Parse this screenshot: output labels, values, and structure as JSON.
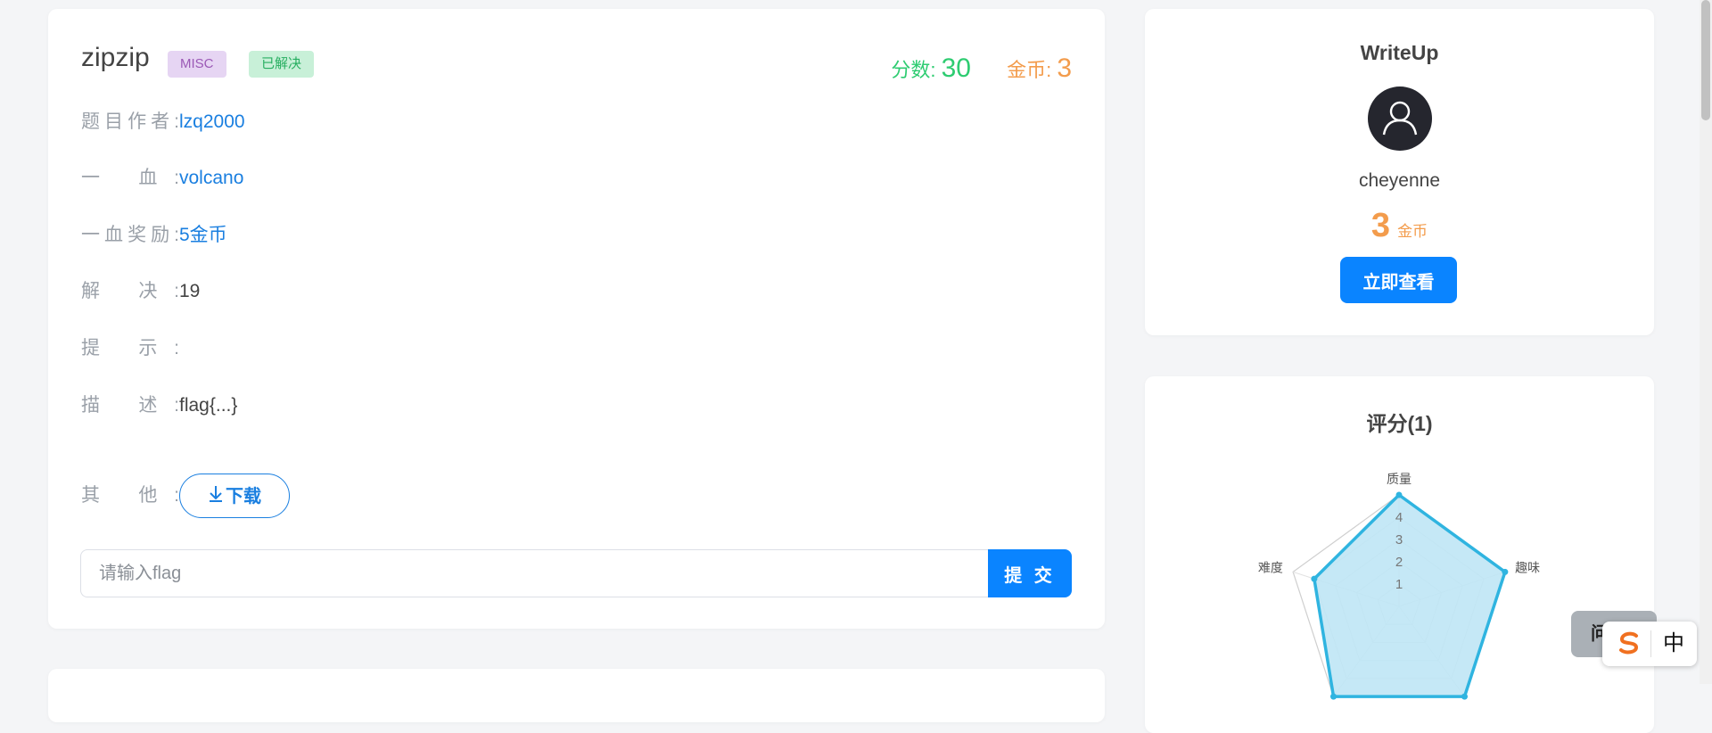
{
  "challenge": {
    "title": "zipzip",
    "category_tag": "MISC",
    "status_tag": "已解决",
    "score_label": "分数:",
    "score_value": "30",
    "coin_label": "金币:",
    "coin_value": "3",
    "author_label": "题目作者:",
    "author": "lzq2000",
    "first_blood_label": "一      血:",
    "first_blood": "volcano",
    "bonus_label": "一血奖励:",
    "bonus": "5金币",
    "solved_label": "解      决:",
    "solved": "19",
    "hint_label": "提      示:",
    "hint": "",
    "desc_label": "描      述:",
    "description": "flag{...}",
    "other_label": "其      他:",
    "download_label": "下载",
    "download_icon": "download-arrow-icon"
  },
  "flag_form": {
    "placeholder": "请输入flag",
    "value": "",
    "submit_label": "提 交"
  },
  "writeup": {
    "title": "WriteUp",
    "avatar_icon": "user-avatar-icon",
    "username": "cheyenne",
    "coins": "3",
    "coins_unit": "金币",
    "view_label": "立即查看"
  },
  "rating": {
    "title": "评分(1)"
  },
  "chart_data": {
    "type": "radar",
    "axes": [
      "质量",
      "趣味",
      "",
      "",
      "难度"
    ],
    "scale_ticks": [
      "1",
      "2",
      "3",
      "4"
    ],
    "max": 5,
    "series": [
      {
        "values": [
          5,
          5,
          5,
          5,
          4
        ]
      }
    ],
    "color": "#2fb4e0",
    "fill": "#bfe6f5"
  },
  "floating": {
    "help_label": "问",
    "ime_icon": "sogou-logo-icon",
    "ime_lang": "中"
  },
  "colors": {
    "link": "#1a7fe0",
    "primary_button": "#0a84ff",
    "score_green": "#2ecc71",
    "coin_orange": "#f39c4c"
  }
}
